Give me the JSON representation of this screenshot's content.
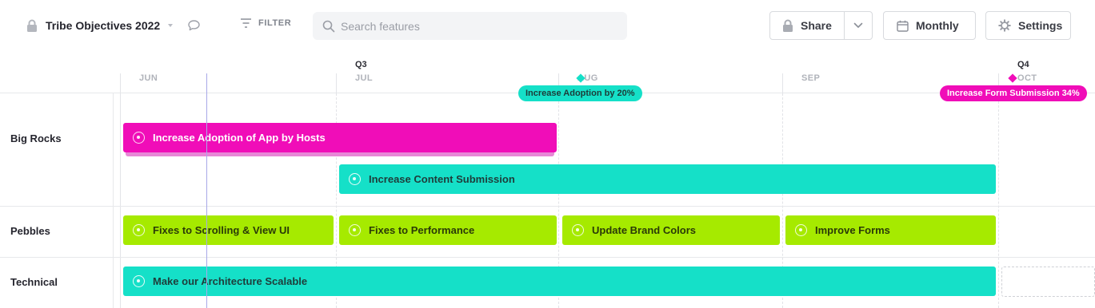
{
  "colors": {
    "pink": "#f00db8",
    "teal": "#15e0c8",
    "green": "#a6ea00",
    "today_line": "#a8a9e8"
  },
  "toolbar": {
    "title": "Tribe Objectives 2022",
    "title_icon": "lock-icon",
    "comment_icon": "comment-icon",
    "filter_label": "FILTER",
    "search_placeholder": "Search features",
    "share_label": "Share",
    "monthly_label": "Monthly",
    "settings_label": "Settings"
  },
  "timeline": {
    "quarters": [
      "Q3",
      "Q4"
    ],
    "months": [
      "JUN",
      "JUL",
      "AUG",
      "SEP",
      "OCT"
    ]
  },
  "milestones": [
    {
      "label": "Increase Adoption by 20%",
      "color": "teal"
    },
    {
      "label": "Increase Form Submission 34%",
      "color": "pink"
    }
  ],
  "lanes": [
    {
      "name": "Big Rocks"
    },
    {
      "name": "Pebbles"
    },
    {
      "name": "Technical"
    }
  ],
  "bars": [
    {
      "label": "Increase Adoption of App by Hosts",
      "lane": "Big Rocks",
      "color": "pink"
    },
    {
      "label": "Increase Content Submission",
      "lane": "Big Rocks",
      "color": "teal"
    },
    {
      "label": "Fixes to Scrolling & View UI",
      "lane": "Pebbles",
      "color": "green"
    },
    {
      "label": "Fixes to Performance",
      "lane": "Pebbles",
      "color": "green"
    },
    {
      "label": "Update Brand Colors",
      "lane": "Pebbles",
      "color": "green"
    },
    {
      "label": "Improve Forms",
      "lane": "Pebbles",
      "color": "green"
    },
    {
      "label": "Make our Architecture Scalable",
      "lane": "Technical",
      "color": "teal"
    }
  ]
}
